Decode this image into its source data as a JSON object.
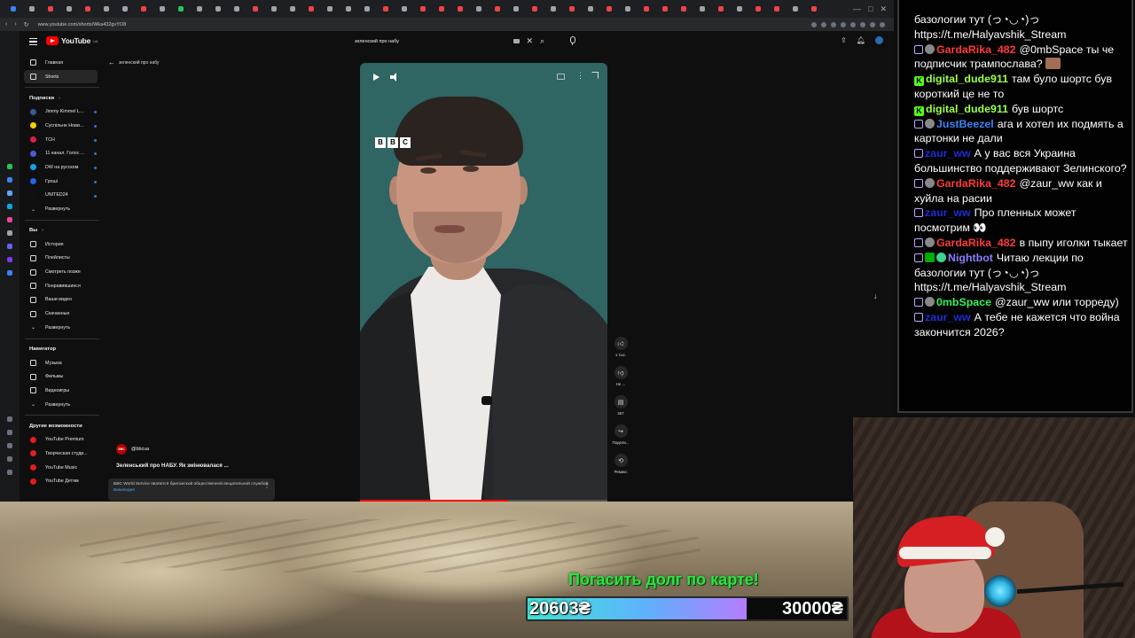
{
  "browser": {
    "url": "www.youtube.com/shorts/Wka432gvYO8",
    "tab_colors": [
      "#3b82f6",
      "#9ca3af",
      "#ef4444",
      "#9ca3af",
      "#ef4444",
      "#9ca3af",
      "#9ca3af",
      "#ef4444",
      "#9ca3af",
      "#22c55e",
      "#9ca3af",
      "#9ca3af",
      "#9ca3af",
      "#ef4444",
      "#9ca3af",
      "#9ca3af",
      "#ef4444",
      "#9ca3af",
      "#9ca3af",
      "#9ca3af",
      "#ef4444",
      "#9ca3af",
      "#ef4444",
      "#ef4444",
      "#ef4444",
      "#9ca3af",
      "#ef4444",
      "#9ca3af",
      "#ef4444",
      "#9ca3af",
      "#ef4444",
      "#9ca3af",
      "#ef4444",
      "#9ca3af",
      "#ef4444",
      "#ef4444",
      "#ef4444",
      "#9ca3af",
      "#ef4444",
      "#9ca3af",
      "#ef4444",
      "#ef4444",
      "#9ca3af",
      "#ef4444"
    ]
  },
  "youtube": {
    "logo_text": "YouTube",
    "logo_sup": "UA",
    "search_value": "зеленский про набу",
    "breadcrumb": "зеленский про набу",
    "sidebar": {
      "main": [
        {
          "label": "Главная",
          "icon": "home-icon"
        },
        {
          "label": "Shorts",
          "icon": "shorts-icon",
          "active": true
        }
      ],
      "subs_header": "Подписки",
      "subs": [
        {
          "label": "Jimmy Kimmel L...",
          "color": "#3b5998"
        },
        {
          "label": "Суспільне Нови...",
          "color": "#f5d000"
        },
        {
          "label": "ТСН",
          "color": "#e11d48"
        },
        {
          "label": "11 канал. Голос ...",
          "color": "#4b5bd6"
        },
        {
          "label": "DW на русском",
          "color": "#0ea5e9"
        },
        {
          "label": "Гроші",
          "color": "#2563eb"
        },
        {
          "label": "UNITED24",
          "color": "#111111"
        }
      ],
      "expand_label": "Развернуть",
      "you_header": "Вы",
      "you": [
        {
          "label": "История"
        },
        {
          "label": "Плейлисты"
        },
        {
          "label": "Смотреть позже"
        },
        {
          "label": "Понравившиеся"
        },
        {
          "label": "Ваши видео"
        },
        {
          "label": "Скачанные"
        }
      ],
      "nav_header": "Навигатор",
      "nav": [
        {
          "label": "Музыка"
        },
        {
          "label": "Фильмы"
        },
        {
          "label": "Видеоигры"
        }
      ],
      "more_header": "Другие возможности",
      "more": [
        {
          "label": "YouTube Premium"
        },
        {
          "label": "Творческая студи..."
        },
        {
          "label": "YouTube Music"
        },
        {
          "label": "YouTube Детям"
        }
      ]
    },
    "video": {
      "channel": "@bbcua",
      "channel_logo": "BBC",
      "title": "Зеленський про НАБУ. Як змінювалася ...",
      "info_text": "BBC World Service является британской общественной вещательной службой.",
      "info_link": "Википедия",
      "watermark": [
        "B",
        "B",
        "C"
      ],
      "progress_fraction": 0.6
    },
    "actions": [
      {
        "icon": "like-icon",
        "label": "1 тыс."
      },
      {
        "icon": "dislike-icon",
        "label": "Не ..."
      },
      {
        "icon": "comment-icon",
        "label": "267"
      },
      {
        "icon": "share-icon",
        "label": "Подели..."
      },
      {
        "icon": "remix-icon",
        "label": "Ремикс"
      }
    ]
  },
  "donation": {
    "title": "Погасить долг по карте!",
    "current": "20603₴",
    "goal": "30000₴",
    "progress_fraction": 0.6868
  },
  "chat": [
    {
      "badges": [],
      "user": "",
      "text": "базологии тут (っ◔◡◔)っ https://t.me/Halyavshik_Stream"
    },
    {
      "badges": [
        "twitch",
        "mute"
      ],
      "user": "GardaRika_482",
      "color": "#ff3b3b",
      "text": "@0mbSpace ты че подписчик трампослава?",
      "emote": true
    },
    {
      "badges": [
        "kick"
      ],
      "user": "digital_dude911",
      "color": "#9dff4a",
      "text": "там було шортс був короткий це не то"
    },
    {
      "badges": [
        "kick"
      ],
      "user": "digital_dude911",
      "color": "#9dff4a",
      "text": "був шортс"
    },
    {
      "badges": [
        "twitch",
        "mute"
      ],
      "user": "JustBeezel",
      "color": "#3b82f6",
      "text": "ага и хотел их подмять а картонки не дали"
    },
    {
      "badges": [
        "twitch"
      ],
      "user": "zaur_ww",
      "color": "#1f2bd6",
      "text": "А у вас вся Украина большинство поддерживают Зелинского?"
    },
    {
      "badges": [
        "twitch",
        "mute"
      ],
      "user": "GardaRika_482",
      "color": "#ff3b3b",
      "text": "@zaur_ww как и хуйла на расии"
    },
    {
      "badges": [
        "twitch"
      ],
      "user": "zaur_ww",
      "color": "#1f2bd6",
      "text": "Про пленных может посмотрим 👀"
    },
    {
      "badges": [
        "twitch",
        "mute"
      ],
      "user": "GardaRika_482",
      "color": "#ff3b3b",
      "text": "в пыпу иголки тыкает"
    },
    {
      "badges": [
        "twitch",
        "mod",
        "bot"
      ],
      "user": "Nightbot",
      "color": "#8a7dff",
      "text": "Читаю лекции по базологии тут (っ◔◡◔)っ https://t.me/Halyavshik_Stream"
    },
    {
      "badges": [
        "twitch",
        "mute"
      ],
      "user": "0mbSpace",
      "color": "#35f05a",
      "text": "@zaur_ww или торреду)"
    },
    {
      "badges": [
        "twitch"
      ],
      "user": "zaur_ww",
      "color": "#1f2bd6",
      "text": "А тебе не кажется что война закончится 2026?"
    }
  ]
}
